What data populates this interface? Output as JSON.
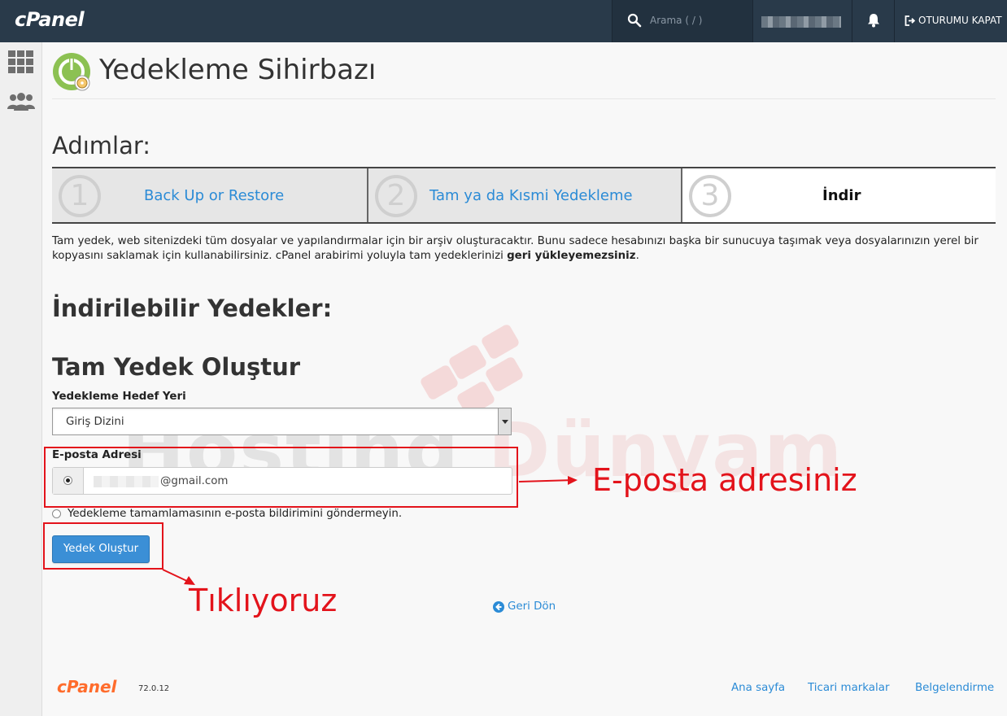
{
  "topbar": {
    "logo": "cPanel",
    "search_placeholder": "Arama ( / )",
    "logout_label": "OTURUMU KAPAT"
  },
  "page": {
    "title": "Yedekleme Sihirbazı"
  },
  "steps": {
    "heading": "Adımlar:",
    "items": [
      {
        "num": "1",
        "label": "Back Up or Restore"
      },
      {
        "num": "2",
        "label": "Tam ya da Kısmi Yedekleme"
      },
      {
        "num": "3",
        "label": "İndir"
      }
    ]
  },
  "description": {
    "text": "Tam yedek, web sitenizdeki tüm dosyalar ve yapılandırmalar için bir arşiv oluşturacaktır. Bunu sadece hesabınızı başka bir sunucuya taşımak veya dosyalarınızın yerel bir kopyasını saklamak için kullanabilirsiniz. cPanel arabirimi yoluyla tam yedeklerinizi ",
    "bold": "geri yükleyemezsiniz",
    "end": "."
  },
  "downloads": {
    "heading": "İndirilebilir Yedekler:"
  },
  "create": {
    "heading": "Tam Yedek Oluştur",
    "destination_label": "Yedekleme Hedef Yeri",
    "destination_value": "Giriş Dizini",
    "email_label": "E-posta Adresi",
    "email_value": "@gmail.com",
    "no_email_option": "Yedekleme tamamlamasının e-posta bildirimini göndermeyin.",
    "button_label": "Yedek Oluştur"
  },
  "goback_label": "Geri Dön",
  "watermark": {
    "part1": "Hosting ",
    "part2": "Dünyam"
  },
  "annotations": {
    "email_note": "E-posta adresiniz",
    "click_note": "Tıklıyoruz",
    "color": "#e3131b"
  },
  "footer": {
    "logo": "cPanel",
    "version": "72.0.12",
    "links": [
      "Ana sayfa",
      "Ticari markalar",
      "Belgelendirme"
    ]
  },
  "colors": {
    "topbar": "#293a4a",
    "link": "#2b8bd6",
    "button": "#3b8fd6",
    "footer_logo": "#ff6c2c"
  }
}
